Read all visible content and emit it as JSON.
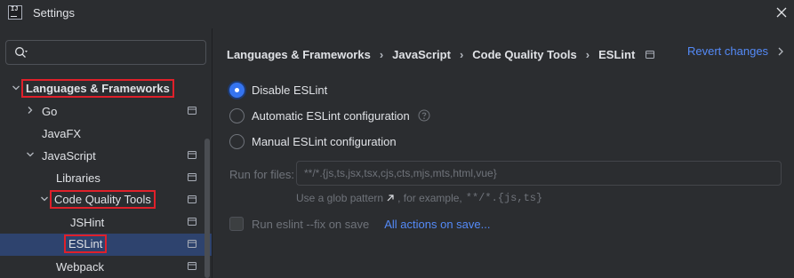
{
  "window": {
    "title": "Settings"
  },
  "sidebar": {
    "search_placeholder": "",
    "items": [
      {
        "label": "Languages & Frameworks"
      },
      {
        "label": "Go"
      },
      {
        "label": "JavaFX"
      },
      {
        "label": "JavaScript"
      },
      {
        "label": "Libraries"
      },
      {
        "label": "Code Quality Tools"
      },
      {
        "label": "JSHint"
      },
      {
        "label": "ESLint"
      },
      {
        "label": "Webpack"
      }
    ]
  },
  "breadcrumb": [
    "Languages & Frameworks",
    "JavaScript",
    "Code Quality Tools",
    "ESLint"
  ],
  "breadcrumb_separator": "›",
  "header": {
    "revert_label": "Revert changes"
  },
  "options": [
    {
      "label": "Disable ESLint"
    },
    {
      "label": "Automatic ESLint configuration"
    },
    {
      "label": "Manual ESLint configuration"
    }
  ],
  "run_for_files": {
    "label": "Run for files:",
    "value": "**/*.{js,ts,jsx,tsx,cjs,cts,mjs,mts,html,vue}",
    "hint_prefix": "Use a glob pattern",
    "hint_middle": ", for example,",
    "hint_example": "**/*.{js,ts}"
  },
  "fix_on_save": {
    "label": "Run eslint --fix on save",
    "link": "All actions on save..."
  },
  "colors": {
    "accent": "#3574f0",
    "link": "#548af7",
    "selection": "#2e436e",
    "highlight_box": "#e0202a"
  }
}
